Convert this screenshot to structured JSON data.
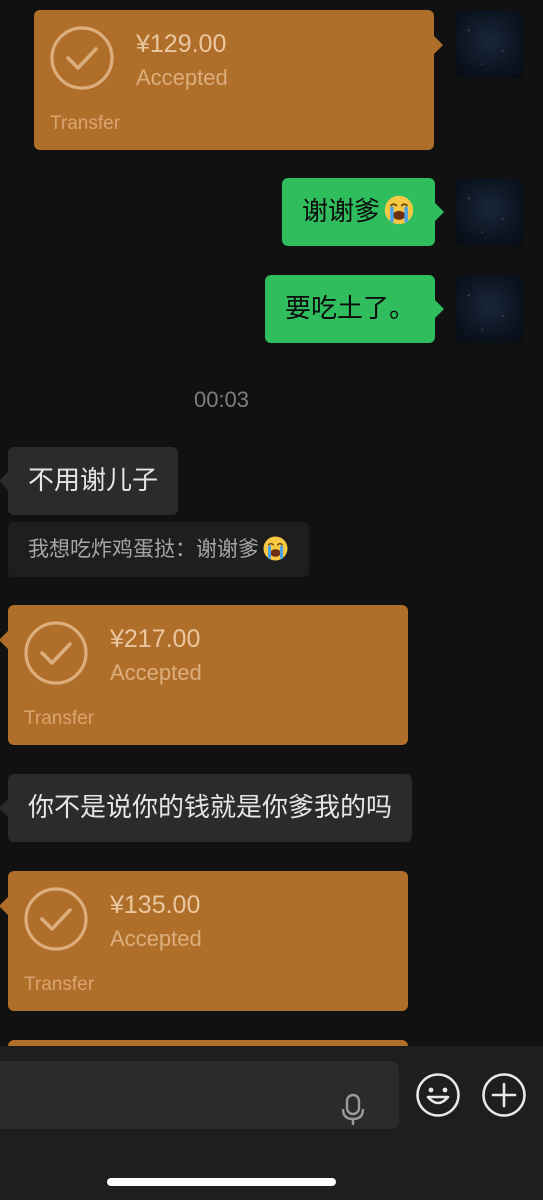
{
  "messages": {
    "transfer1": {
      "amount": "¥129.00",
      "status": "Accepted",
      "label": "Transfer"
    },
    "sent1": {
      "text": "谢谢爹",
      "emoji": "loudly-crying-face-icon"
    },
    "sent2": {
      "text": "要吃土了。"
    },
    "timestamp": "00:03",
    "recv1": {
      "text": "不用谢儿子"
    },
    "quote1": {
      "text": "我想吃炸鸡蛋挞：谢谢爹",
      "emoji": "loudly-crying-face-icon"
    },
    "transfer2": {
      "amount": "¥217.00",
      "status": "Accepted",
      "label": "Transfer"
    },
    "recv2": {
      "text": "你不是说你的钱就是你爹我的吗"
    },
    "transfer3": {
      "amount": "¥135.00",
      "status": "Accepted",
      "label": "Transfer"
    }
  },
  "input_bar": {
    "voice_icon": "microphone-icon",
    "emoji_icon": "smiley-face-icon",
    "more_icon": "plus-circle-icon"
  },
  "colors": {
    "background": "#111111",
    "transfer_bubble": "#b06e2b",
    "sent_bubble": "#2fbd5e",
    "received_bubble": "#2b2b2b"
  }
}
